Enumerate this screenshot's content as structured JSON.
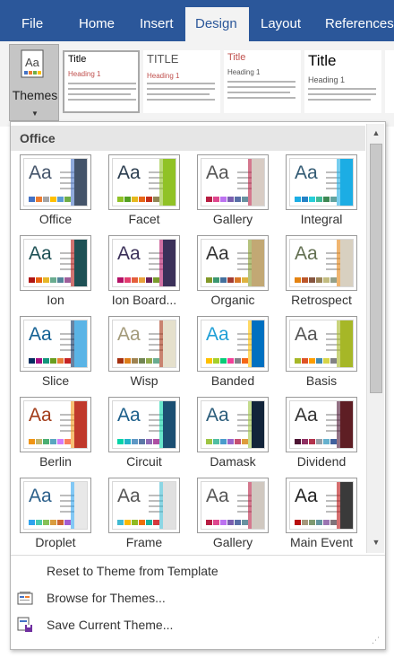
{
  "tabs": [
    {
      "label": "File",
      "active": false
    },
    {
      "label": "Home",
      "active": false
    },
    {
      "label": "Insert",
      "active": false
    },
    {
      "label": "Design",
      "active": true
    },
    {
      "label": "Layout",
      "active": false
    },
    {
      "label": "References",
      "active": false
    }
  ],
  "ribbon": {
    "themes_button": "Themes",
    "style_gallery": [
      {
        "title": "Title",
        "heading": "Heading 1",
        "title_color": "#000000",
        "heading_color": "#c0504d"
      },
      {
        "title": "TITLE",
        "heading": "Heading 1",
        "title_color": "#555555",
        "heading_color": "#c0504d"
      },
      {
        "title": "Title",
        "heading": "Heading 1",
        "title_color": "#c0504d",
        "heading_color": "#555555"
      },
      {
        "title": "Title",
        "heading": "Heading 1",
        "title_color": "#000000",
        "heading_color": "#555555"
      }
    ]
  },
  "dropdown": {
    "section": "Office",
    "themes": [
      {
        "name": "Office",
        "aa_color": "#44546a",
        "accent": "#44546a",
        "swatches": [
          "#4472c4",
          "#ed7d31",
          "#a5a5a5",
          "#ffc000",
          "#5b9bd5",
          "#70ad47"
        ]
      },
      {
        "name": "Facet",
        "aa_color": "#2c3e50",
        "accent": "#90c226",
        "swatches": [
          "#90c226",
          "#54a021",
          "#e6b91e",
          "#e76618",
          "#c42f1a",
          "#918655"
        ]
      },
      {
        "name": "Gallery",
        "aa_color": "#555555",
        "accent": "#d8ccc4",
        "swatches": [
          "#b71e42",
          "#de478e",
          "#bc72f0",
          "#795faf",
          "#586ea6",
          "#6892a0"
        ]
      },
      {
        "name": "Integral",
        "aa_color": "#335b74",
        "accent": "#1cade4",
        "swatches": [
          "#1cade4",
          "#2683c6",
          "#27ced7",
          "#42ba97",
          "#3e8853",
          "#62a39f"
        ]
      },
      {
        "name": "Ion",
        "aa_color": "#1e5155",
        "accent": "#1e5155",
        "swatches": [
          "#b01513",
          "#ea6312",
          "#e6b729",
          "#6aac90",
          "#54849a",
          "#9e5e9b"
        ]
      },
      {
        "name": "Ion Board...",
        "aa_color": "#3b3059",
        "accent": "#3b3059",
        "swatches": [
          "#b31166",
          "#e33d6f",
          "#e45f3c",
          "#e9a23b",
          "#6a1f5b",
          "#7a9c2d"
        ]
      },
      {
        "name": "Organic",
        "aa_color": "#333333",
        "accent": "#c2a874",
        "swatches": [
          "#83992a",
          "#3c9770",
          "#44709d",
          "#a23c33",
          "#d97828",
          "#deb340"
        ]
      },
      {
        "name": "Retrospect",
        "aa_color": "#637052",
        "accent": "#d8d0c0",
        "swatches": [
          "#e48312",
          "#bd582c",
          "#865640",
          "#9b8357",
          "#c2bc80",
          "#94a088"
        ]
      },
      {
        "name": "Slice",
        "aa_color": "#146194",
        "accent": "#5ab4e6",
        "swatches": [
          "#052f61",
          "#a50e82",
          "#14967c",
          "#6a9e1f",
          "#e87d37",
          "#c62324"
        ]
      },
      {
        "name": "Wisp",
        "aa_color": "#a39a7a",
        "accent": "#e5e0cc",
        "swatches": [
          "#a53010",
          "#de7e18",
          "#9f8351",
          "#728653",
          "#92aa4c",
          "#6aac91"
        ]
      },
      {
        "name": "Banded",
        "aa_color": "#1f9fd6",
        "accent": "#0070c0",
        "swatches": [
          "#ffc000",
          "#a5d028",
          "#08cc78",
          "#f24099",
          "#828288",
          "#f56617"
        ]
      },
      {
        "name": "Basis",
        "aa_color": "#555555",
        "accent": "#a6b727",
        "swatches": [
          "#a6b727",
          "#df5327",
          "#fe9e00",
          "#418ab3",
          "#d7d447",
          "#818183"
        ]
      },
      {
        "name": "Berlin",
        "aa_color": "#a23b18",
        "accent": "#c0392b",
        "swatches": [
          "#f09415",
          "#c1b56b",
          "#4baf73",
          "#5aa6c0",
          "#d17df9",
          "#fa7e5c"
        ]
      },
      {
        "name": "Circuit",
        "aa_color": "#1b5e8a",
        "accent": "#1b4f72",
        "swatches": [
          "#03d4a8",
          "#21b2c8",
          "#5e98c5",
          "#5c78a6",
          "#8f6ab5",
          "#ad4fa2"
        ]
      },
      {
        "name": "Damask",
        "aa_color": "#2a5c7a",
        "accent": "#12243a",
        "swatches": [
          "#9ec544",
          "#50bea3",
          "#4a9ccc",
          "#9a66ca",
          "#c54f71",
          "#de9c3c"
        ]
      },
      {
        "name": "Dividend",
        "aa_color": "#333333",
        "accent": "#5e1e24",
        "swatches": [
          "#4d1434",
          "#903163",
          "#b2324b",
          "#969fa7",
          "#66b1ce",
          "#40619d"
        ]
      },
      {
        "name": "Droplet",
        "aa_color": "#2b5f8a",
        "accent": "#e8e8e8",
        "swatches": [
          "#2fa3ee",
          "#4bcaad",
          "#86c157",
          "#d99c3f",
          "#ce6633",
          "#a35dd1"
        ]
      },
      {
        "name": "Frame",
        "aa_color": "#555555",
        "accent": "#e0e0e0",
        "swatches": [
          "#40bad2",
          "#fab900",
          "#90bb23",
          "#ee7008",
          "#1ab39f",
          "#d5393d"
        ]
      },
      {
        "name": "Gallery",
        "aa_color": "#555555",
        "accent": "#d0c8c0",
        "swatches": [
          "#b71e42",
          "#de478e",
          "#bc72f0",
          "#795faf",
          "#586ea6",
          "#6892a0"
        ]
      },
      {
        "name": "Main Event",
        "aa_color": "#222222",
        "accent": "#3a3a3a",
        "swatches": [
          "#b80e0f",
          "#a6987d",
          "#7f9a71",
          "#64969f",
          "#9b75b2",
          "#80737a"
        ]
      }
    ],
    "menu": [
      {
        "label": "Reset to Theme from Template",
        "has_icon": false
      },
      {
        "label": "Browse for Themes...",
        "has_icon": true,
        "icon": "browse-folder-icon"
      },
      {
        "label": "Save Current Theme...",
        "has_icon": true,
        "icon": "save-theme-icon"
      }
    ]
  }
}
